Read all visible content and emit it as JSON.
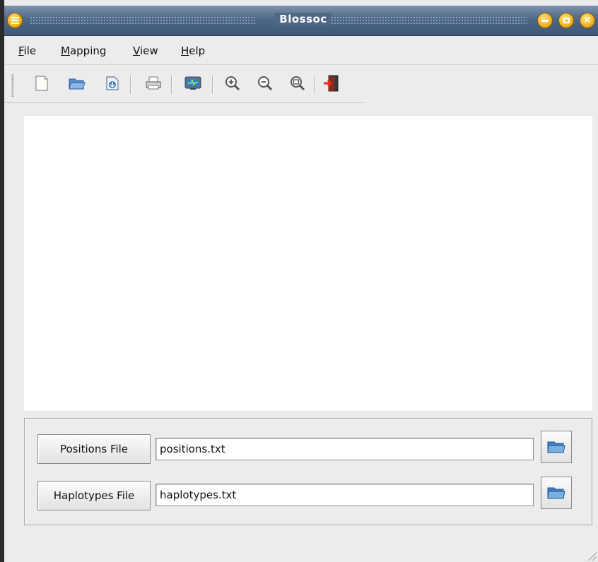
{
  "window": {
    "title": "Blossoc"
  },
  "menu": {
    "items": [
      {
        "label": "File",
        "mnemonic": "F",
        "rest": "ile"
      },
      {
        "label": "Mapping",
        "mnemonic": "M",
        "rest": "apping"
      },
      {
        "label": "View",
        "mnemonic": "V",
        "rest": "iew"
      },
      {
        "label": "Help",
        "mnemonic": "H",
        "rest": "elp"
      }
    ]
  },
  "toolbar": {
    "icons": [
      "new-file-icon",
      "open-folder-icon",
      "save-icon",
      "print-icon",
      "monitor-icon",
      "zoom-in-icon",
      "zoom-out-icon",
      "zoom-fit-icon",
      "exit-icon"
    ]
  },
  "files": {
    "positions": {
      "button_label": "Positions File",
      "value": "positions.txt"
    },
    "haplotypes": {
      "button_label": "Haplotypes File",
      "value": "haplotypes.txt"
    }
  },
  "colors": {
    "titlebar": "#4f6888",
    "titlebar_button": "#f3b21b",
    "window_bg": "#ececec",
    "folder_blue": "#3f7fc6"
  }
}
